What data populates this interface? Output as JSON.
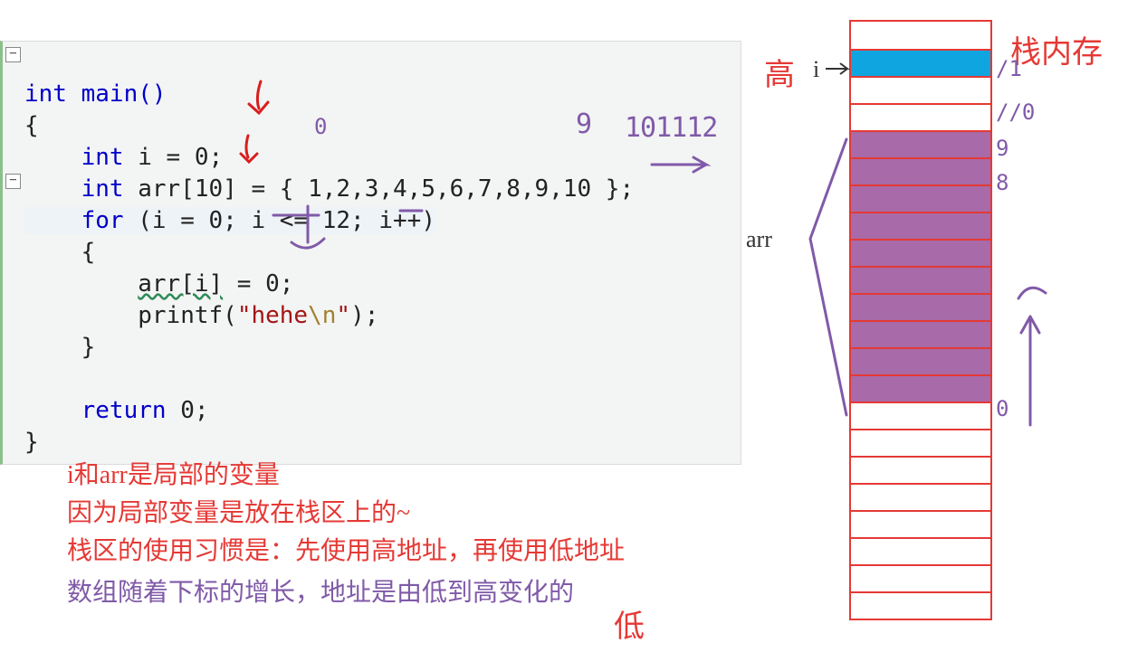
{
  "code": {
    "sig": "int main()",
    "open": "{",
    "decl_i": {
      "kw": "int",
      "rest": " i = 0;"
    },
    "decl_arr": {
      "kw": "int",
      "rest": " arr[10] = { 1,2,3,4,5,6,7,8,9,10 };"
    },
    "for": {
      "kw": "for",
      "rest": " (i = 0; i <= 12; i++)"
    },
    "body_open": "{",
    "assign_a": "arr[i]",
    "assign_b": " = 0;",
    "printf_a": "printf(",
    "printf_str": "\"hehe",
    "printf_esc": "\\n",
    "printf_end": "\");",
    "body_close": "}",
    "ret": {
      "kw": "return",
      "rest": " 0;"
    },
    "close": "}"
  },
  "notes": {
    "l1": "i和arr是局部的变量",
    "l2": "因为局部变量是放在栈区上的~",
    "l3": "栈区的使用习惯是：先使用高地址，再使用低地址",
    "l4": "数组随着下标的增长，地址是由低到高变化的"
  },
  "labels": {
    "title": "栈内存",
    "high": "高",
    "low": "低",
    "i": "i",
    "arr": "arr",
    "idx9": "9",
    "idx8": "8",
    "idx0": "0"
  },
  "ink": {
    "near_i0": "0",
    "overflow": "9",
    "sequence": "101112",
    "i_addr": "/1",
    "gap_addr": "//0"
  }
}
